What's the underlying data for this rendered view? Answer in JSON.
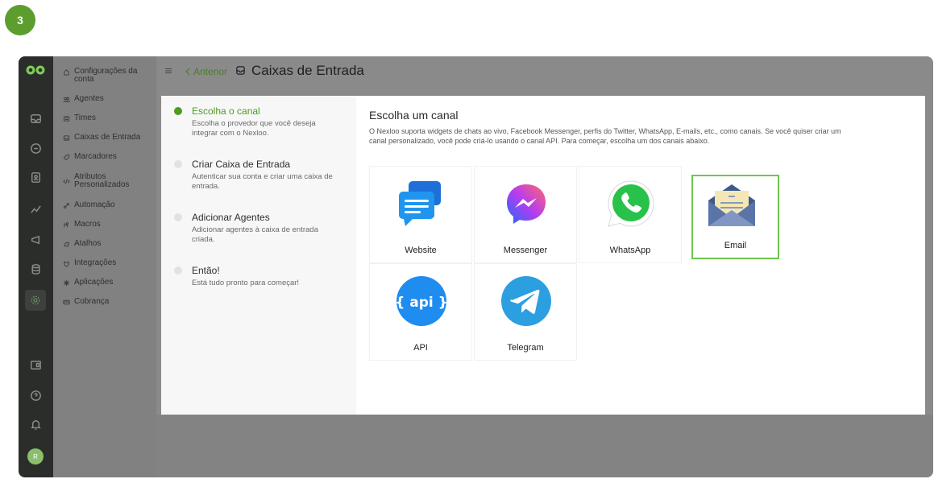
{
  "step_badge": "3",
  "topbar": {
    "back_label": "Anterior",
    "title": "Caixas de Entrada"
  },
  "rail": {
    "icons": [
      "logo-icon",
      "inbox-icon",
      "chat-icon",
      "contacts-icon",
      "reports-icon",
      "campaigns-icon",
      "library-icon",
      "settings-icon",
      "dashboard-icon",
      "help-icon",
      "notifications-icon"
    ],
    "avatar_initial": "R"
  },
  "subnav": {
    "items": [
      {
        "label": "Configurações da conta",
        "icon": "home-icon"
      },
      {
        "label": "Agentes",
        "icon": "agents-icon"
      },
      {
        "label": "Times",
        "icon": "teams-icon"
      },
      {
        "label": "Caixas de Entrada",
        "icon": "inbox-icon"
      },
      {
        "label": "Marcadores",
        "icon": "tag-icon"
      },
      {
        "label": "Atributos Personalizados",
        "icon": "code-icon"
      },
      {
        "label": "Automação",
        "icon": "automation-icon"
      },
      {
        "label": "Macros",
        "icon": "macros-icon"
      },
      {
        "label": "Atalhos",
        "icon": "shortcuts-icon"
      },
      {
        "label": "Integrações",
        "icon": "integrations-icon"
      },
      {
        "label": "Aplicações",
        "icon": "apps-icon"
      },
      {
        "label": "Cobrança",
        "icon": "billing-icon"
      }
    ]
  },
  "steps": [
    {
      "title": "Escolha o canal",
      "desc": "Escolha o provedor que você deseja integrar com o Nexloo.",
      "active": true
    },
    {
      "title": "Criar Caixa de Entrada",
      "desc": "Autenticar sua conta e criar uma caixa de entrada.",
      "active": false
    },
    {
      "title": "Adicionar Agentes",
      "desc": "Adicionar agentes à caixa de entrada criada.",
      "active": false
    },
    {
      "title": "Então!",
      "desc": "Está tudo pronto para começar!",
      "active": false
    }
  ],
  "content": {
    "heading": "Escolha um canal",
    "intro": "O Nexloo suporta widgets de chats ao vivo, Facebook Messenger, perfis do Twitter, WhatsApp, E-mails, etc., como canais. Se você quiser criar um canal personalizado, você pode criá-lo usando o canal API. Para começar, escolha um dos canais abaixo.",
    "channels": [
      {
        "label": "Website",
        "icon": "website-icon"
      },
      {
        "label": "Messenger",
        "icon": "messenger-icon"
      },
      {
        "label": "WhatsApp",
        "icon": "whatsapp-icon"
      },
      {
        "label": "Email",
        "icon": "email-icon",
        "selected": true
      },
      {
        "label": "API",
        "icon": "api-icon"
      },
      {
        "label": "Telegram",
        "icon": "telegram-icon"
      }
    ],
    "api_text": "{ api }"
  },
  "colors": {
    "accent": "#4d9b22",
    "selected_border": "#6cc84b",
    "badge": "#5c9d2e"
  }
}
